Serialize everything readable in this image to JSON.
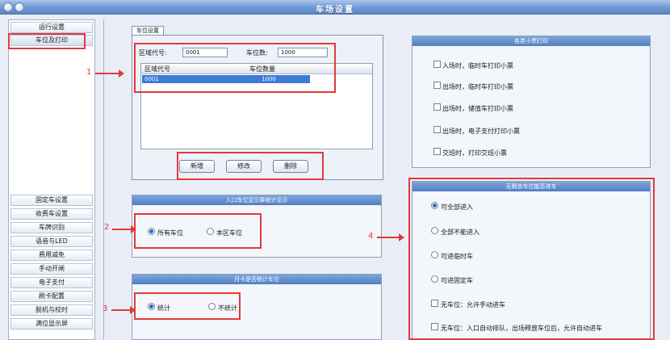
{
  "window": {
    "title": "车场设置"
  },
  "sidebar": {
    "items": [
      {
        "label": "运行设置"
      },
      {
        "label": "车位及打印"
      },
      {
        "label": "固定车设置"
      },
      {
        "label": "收费车设置"
      },
      {
        "label": "车牌识别"
      },
      {
        "label": "语音与LED"
      },
      {
        "label": "费用减免"
      },
      {
        "label": "手动开闸"
      },
      {
        "label": "电子支付"
      },
      {
        "label": "刷卡配置"
      },
      {
        "label": "脱机与校时"
      },
      {
        "label": "满位显示屏"
      }
    ]
  },
  "parking": {
    "tab_label": "车位设置",
    "zone_code_label": "区域代号:",
    "zone_code_value": "0001",
    "space_count_label": "车位数:",
    "space_count_value": "1000",
    "table": {
      "columns": [
        "区域代号",
        "车位数量"
      ],
      "rows": [
        {
          "zone": "0001",
          "count": "1000"
        }
      ]
    },
    "buttons": {
      "add": "新增",
      "edit": "修改",
      "delete": "删除"
    }
  },
  "entrance_display": {
    "title": "入口车位显示屏统计显示",
    "options": [
      "所有车位",
      "本区车位"
    ],
    "selected": 0
  },
  "monthly_count": {
    "title": "月卡是否统计车位",
    "options": [
      "统计",
      "不统计"
    ],
    "selected": 0
  },
  "ticket_print": {
    "title": "各类小票打印",
    "items": [
      "入场时，临时车打印小票",
      "出场时，临时车打印小票",
      "出场时，储值车打印小票",
      "出场时，电子支付打印小票",
      "交班时，打印交班小票"
    ]
  },
  "no_space": {
    "title": "无剩余车位能否进车",
    "radio_options": [
      "可全部进入",
      "全部不能进入",
      "可进临时车",
      "可进固定车"
    ],
    "selected": 0,
    "checks": [
      "无车位：允许手动进车",
      "无车位：入口自动排队，出场释放车位后，允许自动进车"
    ]
  },
  "annotations": [
    "1",
    "2",
    "3",
    "4"
  ],
  "colors": {
    "accent": "#3d7bd6",
    "annotation": "#e23a3a",
    "titlebar": "#6f98d3"
  }
}
